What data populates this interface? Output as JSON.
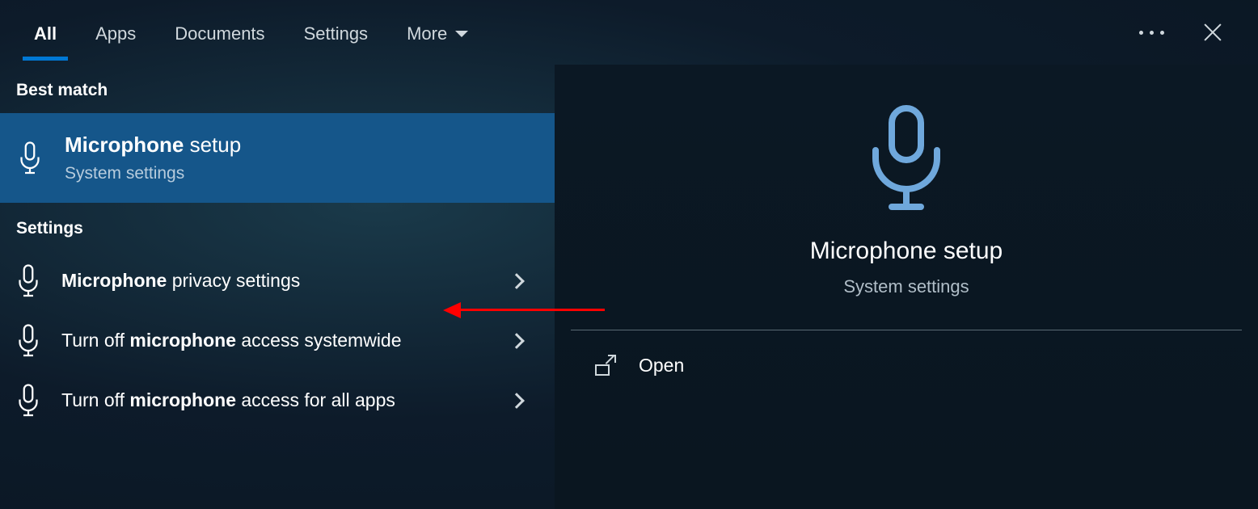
{
  "nav": {
    "tabs": [
      "All",
      "Apps",
      "Documents",
      "Settings",
      "More"
    ],
    "active_index": 0
  },
  "left": {
    "best_match_label": "Best match",
    "best_match": {
      "title_bold": "Microphone",
      "title_rest": " setup",
      "subtitle": "System settings"
    },
    "settings_label": "Settings",
    "settings": [
      {
        "pre": "",
        "bold": "Microphone",
        "post": " privacy settings"
      },
      {
        "pre": "Turn off ",
        "bold": "microphone",
        "post": " access systemwide"
      },
      {
        "pre": "Turn off ",
        "bold": "microphone",
        "post": " access for all apps"
      }
    ]
  },
  "right": {
    "title": "Microphone setup",
    "subtitle": "System settings",
    "action": "Open"
  },
  "colors": {
    "accent": "#0078d4",
    "mic_icon": "#6fa8dc"
  }
}
